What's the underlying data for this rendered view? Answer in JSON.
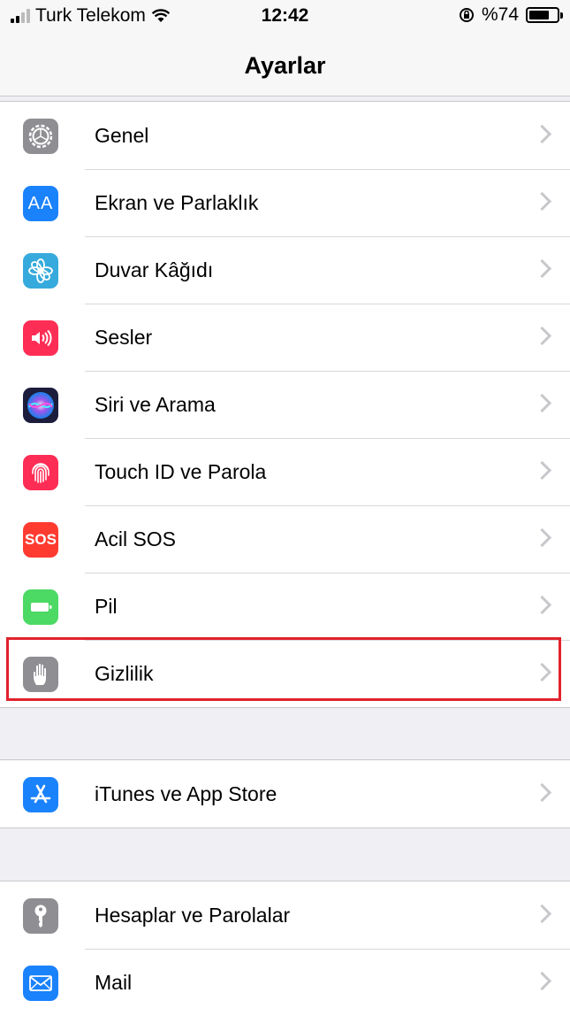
{
  "status_bar": {
    "carrier": "Turk Telekom",
    "time": "12:42",
    "battery_percent_label": "%74",
    "battery_level": 0.74
  },
  "nav": {
    "title": "Ayarlar"
  },
  "groups": [
    {
      "items": [
        {
          "label": "Genel",
          "icon": "gear-icon",
          "color": "#8e8e93"
        },
        {
          "label": "Ekran ve Parlaklık",
          "icon": "display-aa-icon",
          "color": "#1a82fb"
        },
        {
          "label": "Duvar Kâğıdı",
          "icon": "flower-icon",
          "color": "#36aadc"
        },
        {
          "label": "Sesler",
          "icon": "speaker-icon",
          "color": "#fe2d55"
        },
        {
          "label": "Siri ve Arama",
          "icon": "siri-icon",
          "color": "#1c1c3c"
        },
        {
          "label": "Touch ID ve Parola",
          "icon": "fingerprint-icon",
          "color": "#fe2d55"
        },
        {
          "label": "Acil SOS",
          "icon": "sos-icon",
          "color": "#ff3b30"
        },
        {
          "label": "Pil",
          "icon": "battery-icon",
          "color": "#4cd964"
        },
        {
          "label": "Gizlilik",
          "icon": "hand-icon",
          "color": "#8e8e93"
        }
      ]
    },
    {
      "items": [
        {
          "label": "iTunes ve App Store",
          "icon": "app-store-icon",
          "color": "#1a82fb"
        }
      ]
    },
    {
      "items": [
        {
          "label": "Hesaplar ve Parolalar",
          "icon": "key-icon",
          "color": "#8e8e93"
        },
        {
          "label": "Mail",
          "icon": "mail-icon",
          "color": "#1a82fb"
        }
      ]
    }
  ],
  "icon_text": {
    "aa": "AA",
    "sos": "SOS"
  }
}
